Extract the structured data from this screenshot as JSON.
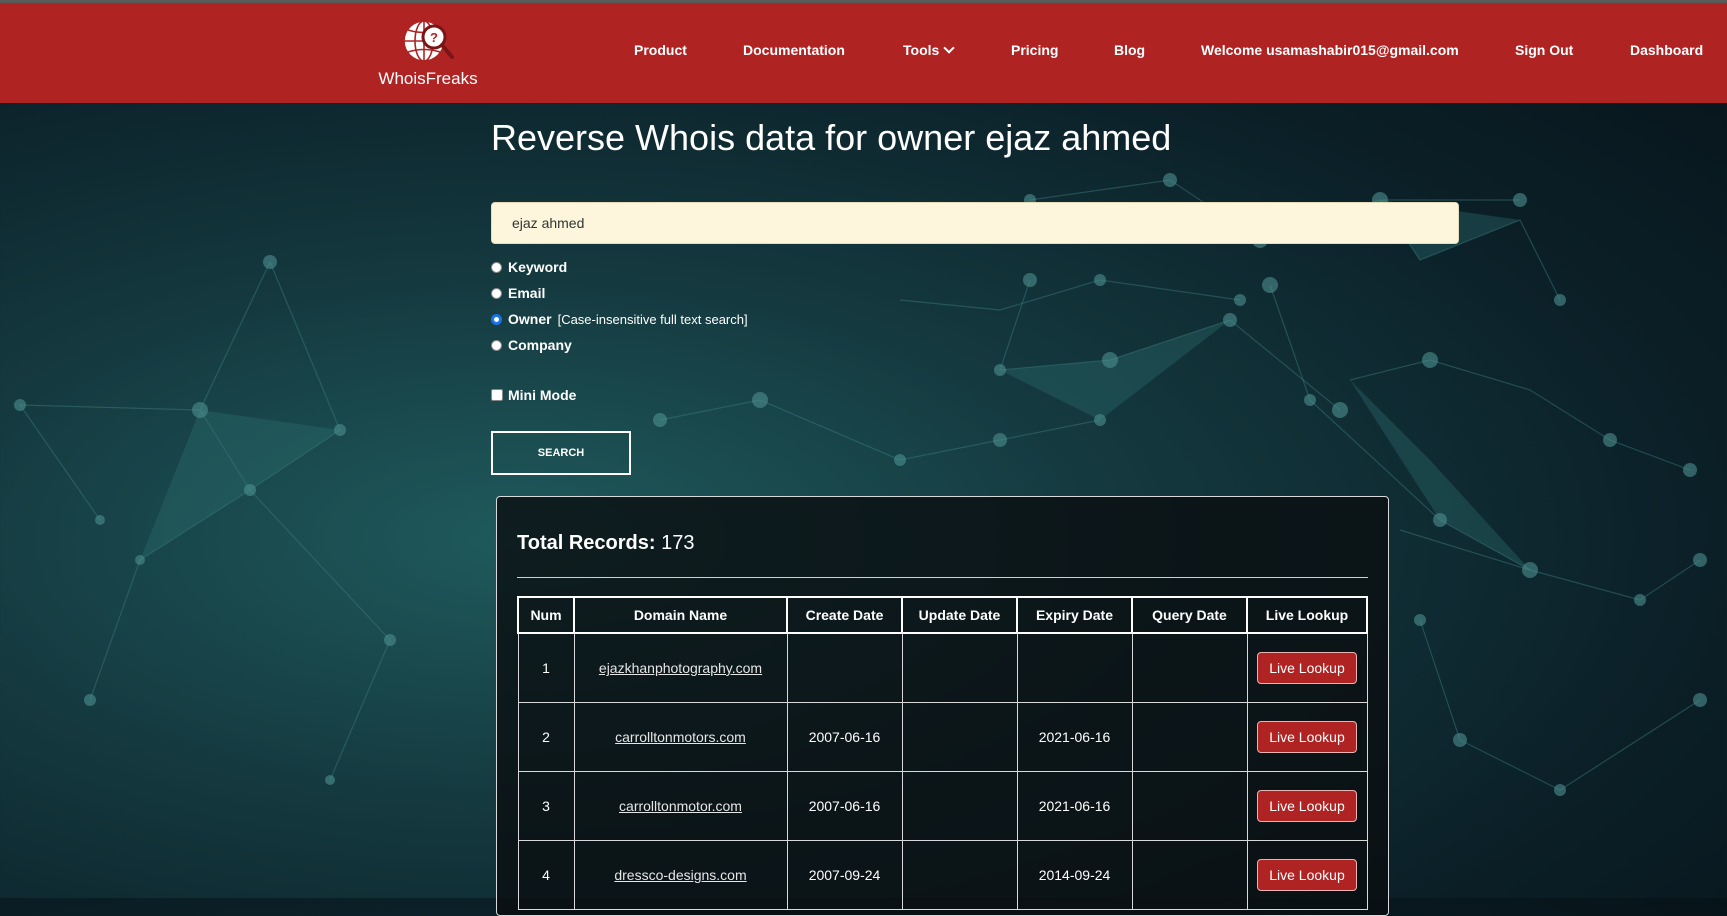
{
  "header": {
    "logo_text": "WhoisFreaks",
    "nav": {
      "product": "Product",
      "documentation": "Documentation",
      "tools": "Tools",
      "pricing": "Pricing",
      "blog": "Blog",
      "welcome": "Welcome usamashabir015@gmail.com",
      "sign_out": "Sign Out",
      "dashboard": "Dashboard"
    }
  },
  "page": {
    "title": "Reverse Whois data for owner ejaz ahmed"
  },
  "search": {
    "value": "ejaz ahmed",
    "options": {
      "keyword": "Keyword",
      "email": "Email",
      "owner": "Owner",
      "owner_hint": "[Case-insensitive full text search]",
      "company": "Company"
    },
    "selected": "owner",
    "mini_mode": "Mini Mode",
    "button": "SEARCH"
  },
  "results": {
    "total_label": "Total Records:",
    "total_value": "173",
    "columns": {
      "num": "Num",
      "domain": "Domain Name",
      "create": "Create Date",
      "update": "Update Date",
      "expiry": "Expiry Date",
      "query": "Query Date",
      "live": "Live Lookup"
    },
    "rows": [
      {
        "num": "1",
        "domain": "ejazkhanphotography.com",
        "create": "",
        "update": "",
        "expiry": "",
        "query": "",
        "live": "Live Lookup"
      },
      {
        "num": "2",
        "domain": "carrolltonmotors.com",
        "create": "2007-06-16",
        "update": "",
        "expiry": "2021-06-16",
        "query": "",
        "live": "Live Lookup"
      },
      {
        "num": "3",
        "domain": "carrolltonmotor.com",
        "create": "2007-06-16",
        "update": "",
        "expiry": "2021-06-16",
        "query": "",
        "live": "Live Lookup"
      },
      {
        "num": "4",
        "domain": "dressco-designs.com",
        "create": "2007-09-24",
        "update": "",
        "expiry": "2014-09-24",
        "query": "",
        "live": "Live Lookup"
      }
    ]
  },
  "colors": {
    "brand_red": "#b02323",
    "input_bg": "#fdf6dd"
  }
}
